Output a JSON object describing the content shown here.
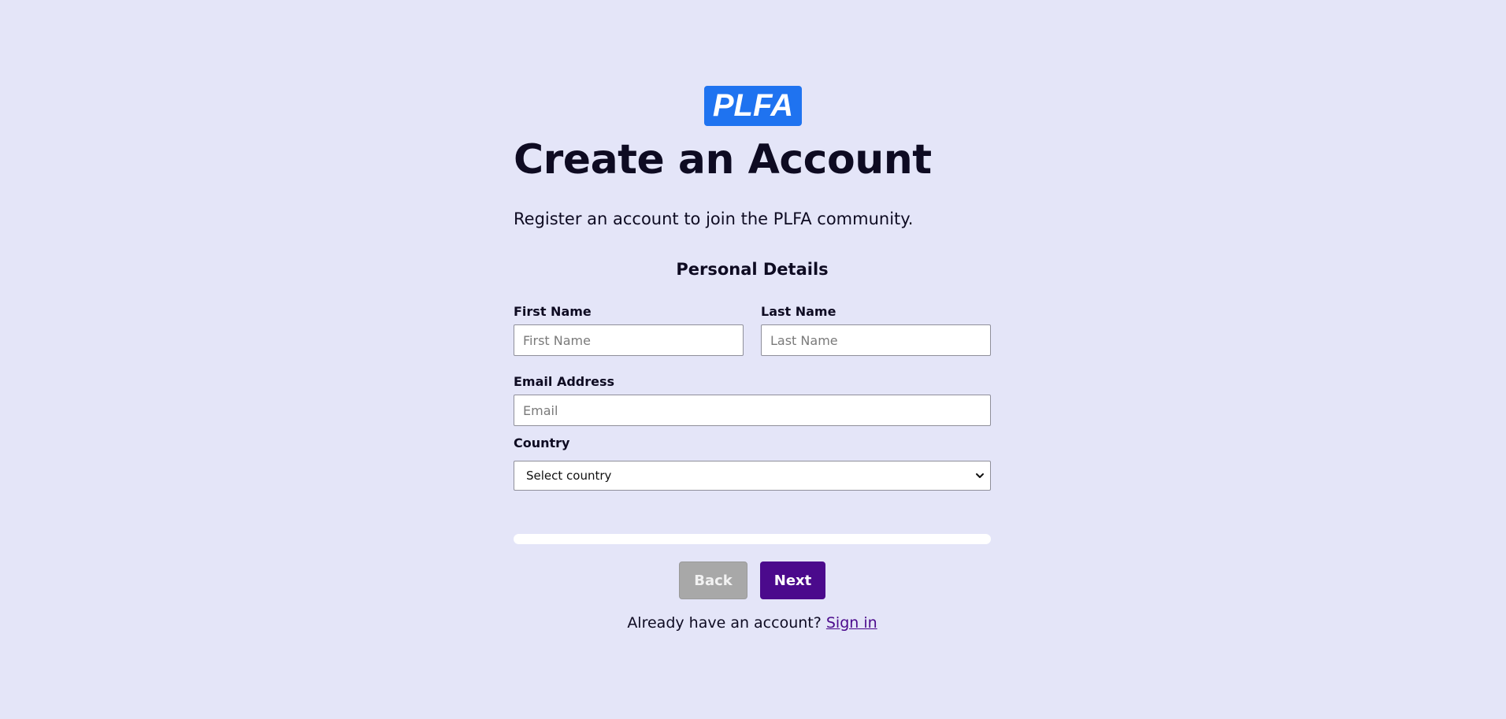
{
  "brand": {
    "logo_text": "PLFA",
    "logo_color": "#1f73f0"
  },
  "page": {
    "title": "Create an Account",
    "subtitle": "Register an account to join the PLFA community."
  },
  "form": {
    "section_title": "Personal Details",
    "first_name": {
      "label": "First Name",
      "placeholder": "First Name",
      "value": ""
    },
    "last_name": {
      "label": "Last Name",
      "placeholder": "Last Name",
      "value": ""
    },
    "email": {
      "label": "Email Address",
      "placeholder": "Email",
      "value": ""
    },
    "country": {
      "label": "Country",
      "selected": "Select country"
    },
    "progress_fraction": 0
  },
  "actions": {
    "back_label": "Back",
    "next_label": "Next",
    "back_color": "#a8a8a8",
    "next_color": "#4b0a8c"
  },
  "footer": {
    "prompt": "Already have an account?",
    "signin_label": "Sign in"
  }
}
